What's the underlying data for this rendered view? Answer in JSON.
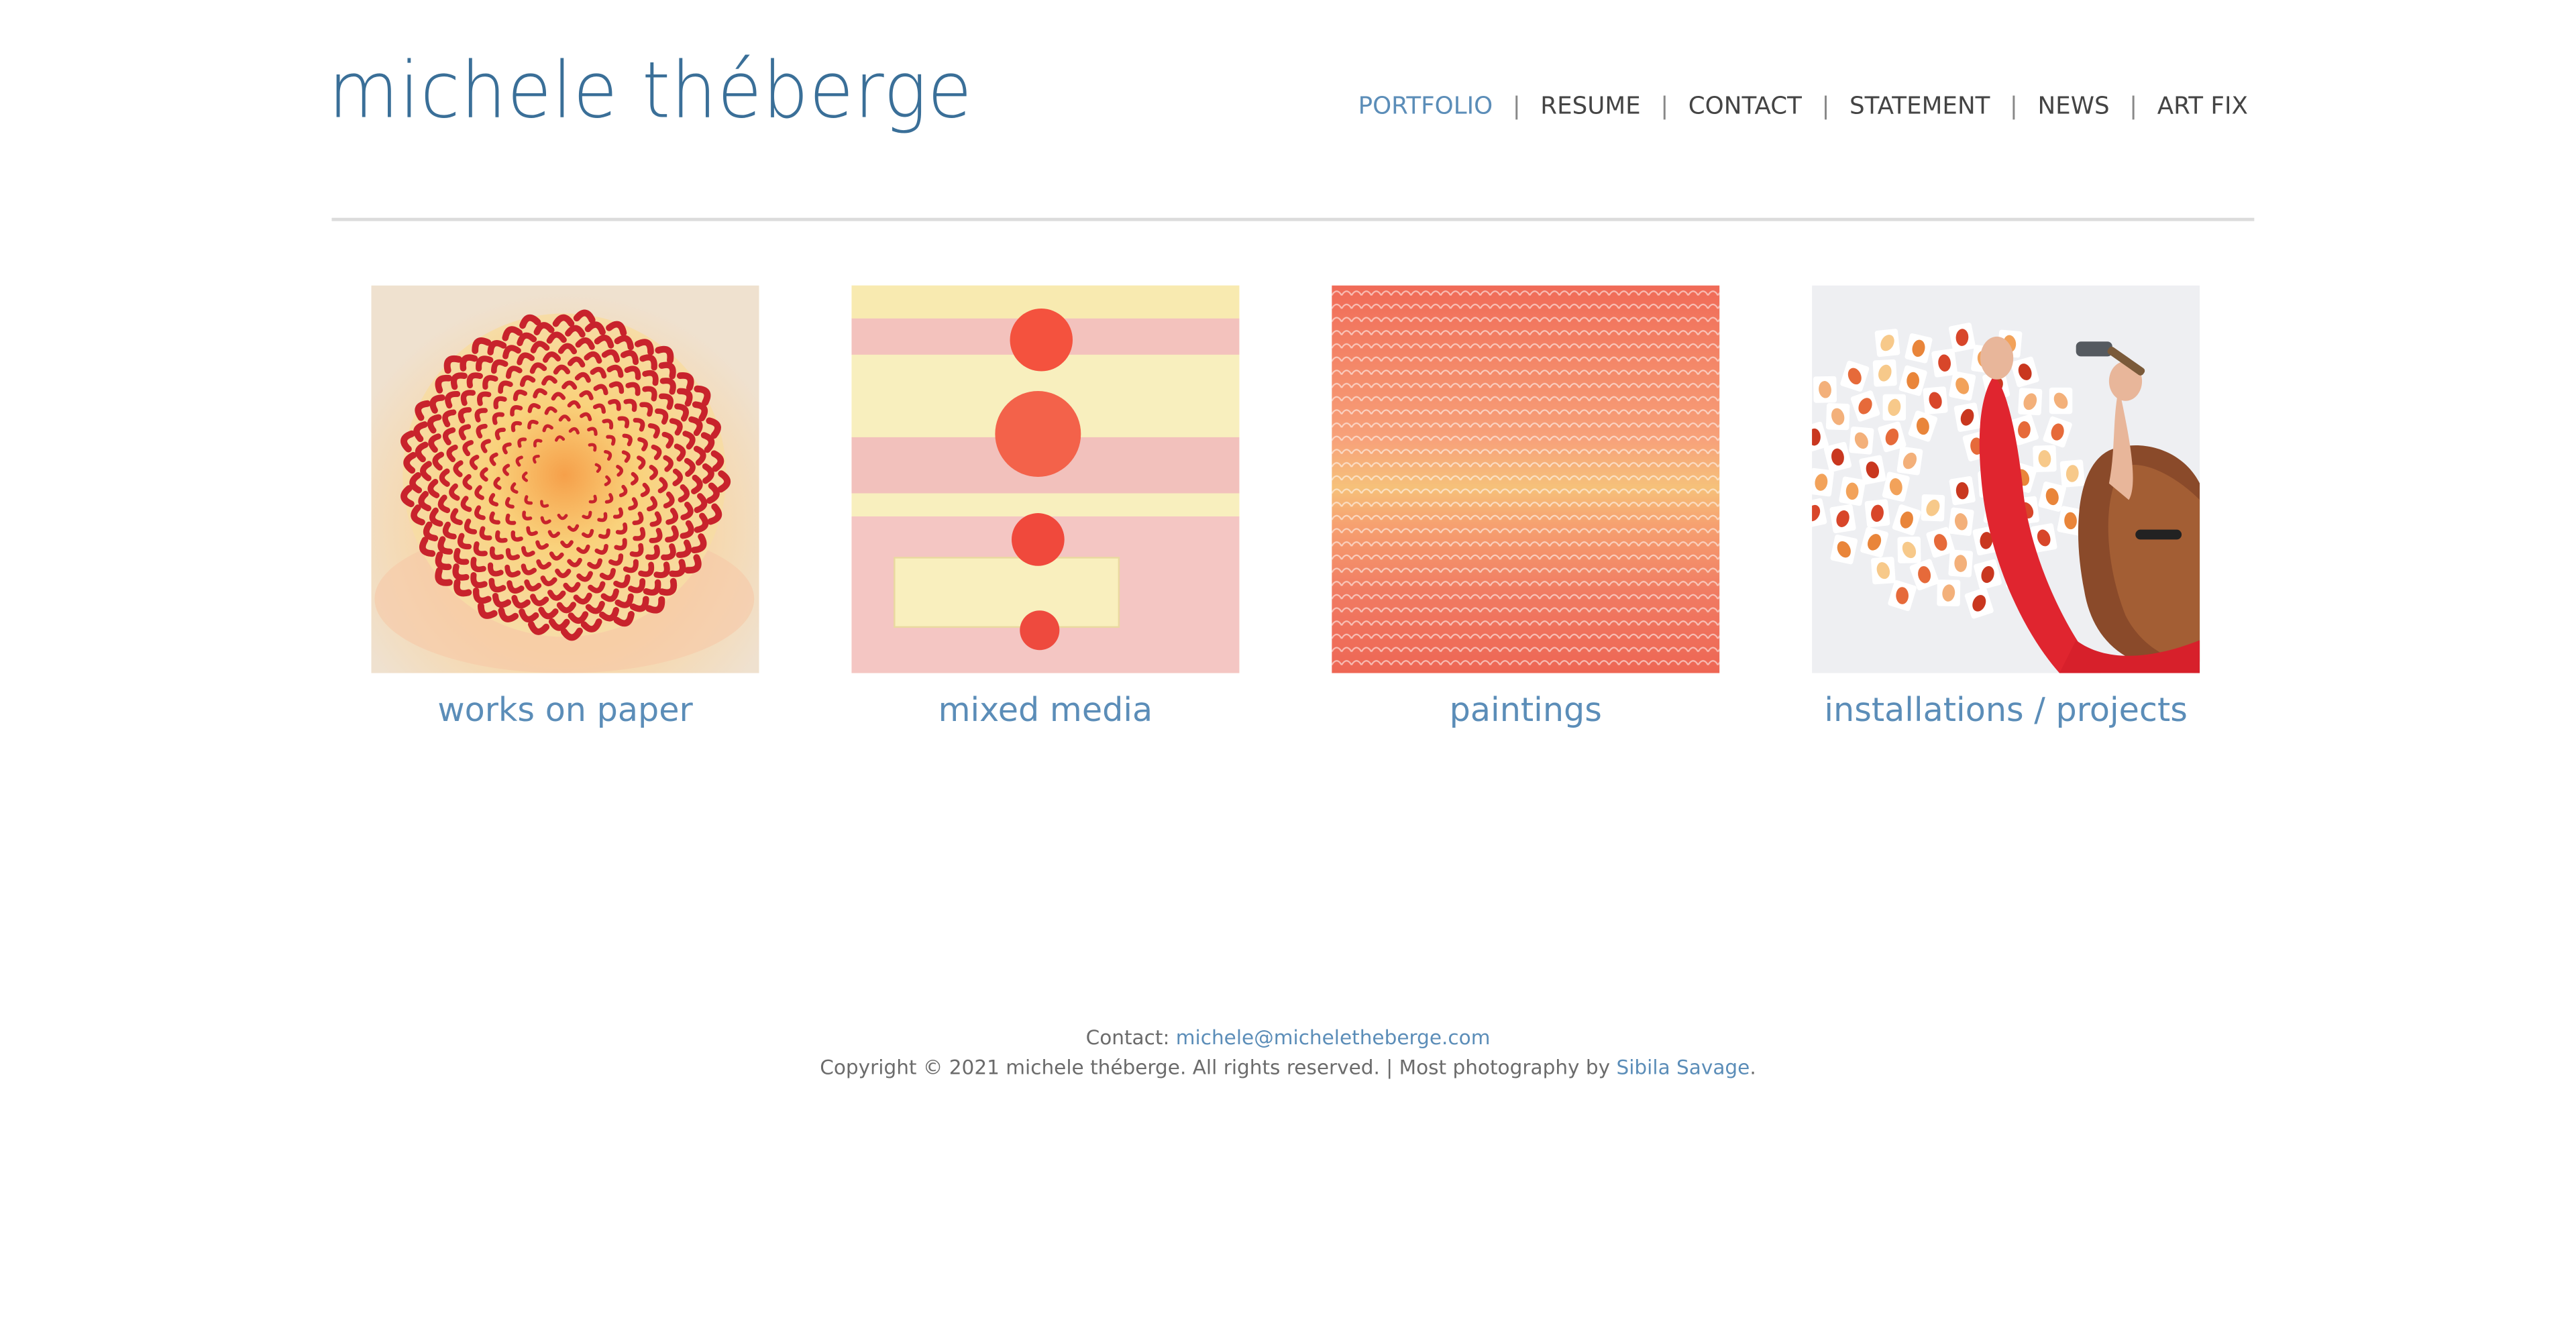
{
  "header": {
    "logo_text": "michele théberge"
  },
  "nav": {
    "items": [
      {
        "label": "PORTFOLIO",
        "active": true
      },
      {
        "label": "RESUME",
        "active": false
      },
      {
        "label": "CONTACT",
        "active": false
      },
      {
        "label": "STATEMENT",
        "active": false
      },
      {
        "label": "NEWS",
        "active": false
      },
      {
        "label": "ART FIX",
        "active": false
      }
    ],
    "separator": "|"
  },
  "portfolio": {
    "tiles": [
      {
        "caption": "works on paper",
        "image": "red-spiral-dot-drawing"
      },
      {
        "caption": "mixed media",
        "image": "red-circles-on-stripes-collage"
      },
      {
        "caption": "paintings",
        "image": "orange-striped-pattern-painting"
      },
      {
        "caption": "installations / projects",
        "image": "artist-installing-wall-piece"
      }
    ]
  },
  "footer": {
    "contact_prefix": "Contact: ",
    "contact_email": "michele@micheletheberge.com",
    "copyright_text": "Copyright © 2021 michele théberge. All rights reserved. | Most photography by ",
    "photographer": "Sibila Savage",
    "period": "."
  },
  "colors": {
    "brand_blue": "#3a6f98",
    "link_blue": "#5b8db8",
    "nav_text": "#444444",
    "footer_text": "#6b6b6b"
  }
}
